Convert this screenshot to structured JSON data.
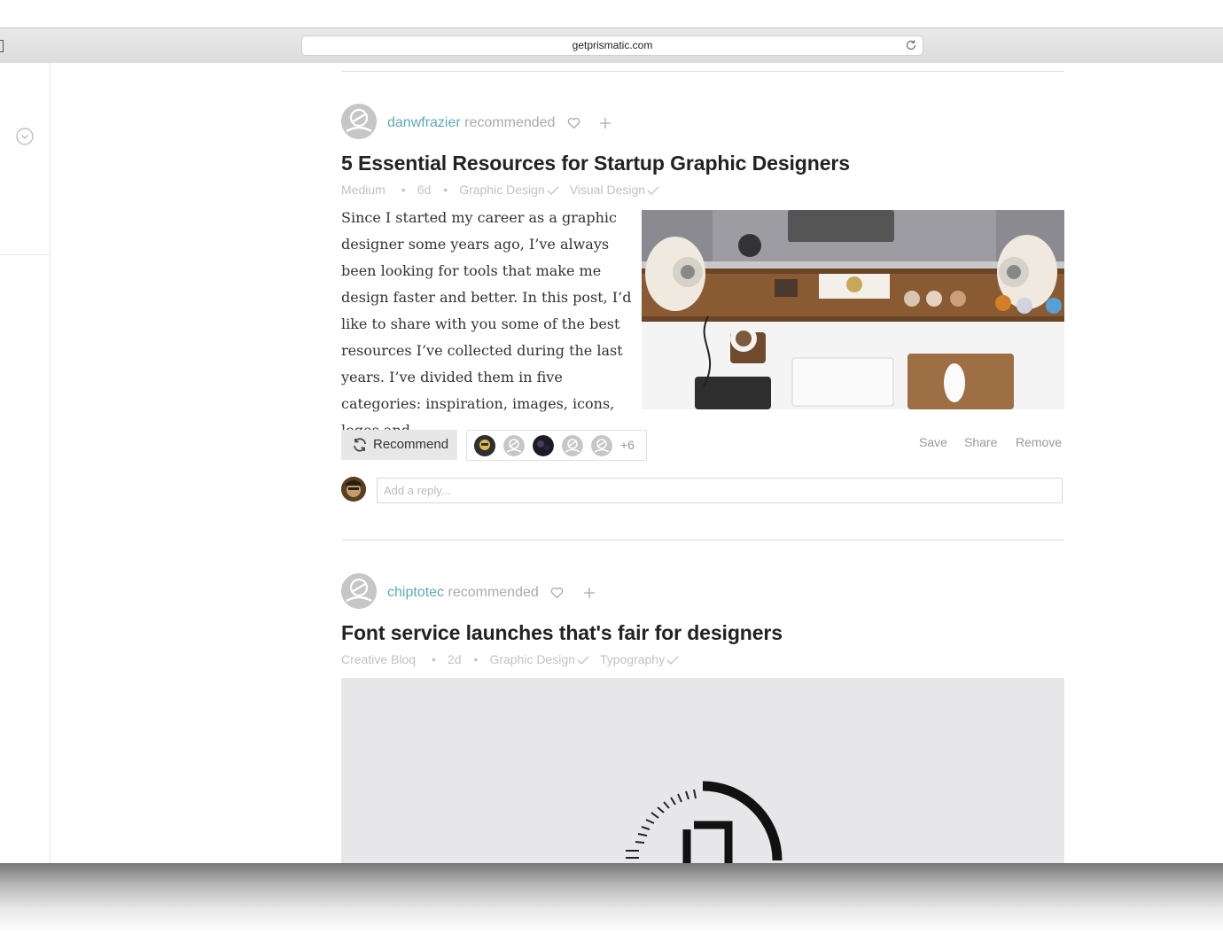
{
  "browser": {
    "url": "getprismatic.com"
  },
  "posts": [
    {
      "recommender": "danwfrazier",
      "recommended_text": "recommended",
      "title": "5 Essential Resources for Startup Graphic Designers",
      "source": "Medium",
      "age": "6d",
      "topics": [
        "Graphic Design",
        "Visual Design"
      ],
      "excerpt": "Since I started my career as a graphic designer some years ago, I’ve always been looking for tools that make me design faster and better. In this post, I’d like to share with you some of the best resources I’ve collected during the last years. I’ve divided them in five categories: inspiration, images, icons, logos and…",
      "recommend_label": "Recommend",
      "more_count": "+6",
      "actions": [
        "Save",
        "Share",
        "Remove"
      ],
      "reply_placeholder": "Add a reply..."
    },
    {
      "recommender": "chiptotec",
      "recommended_text": "recommended",
      "title": "Font service launches that's fair for designers",
      "source": "Creative Bloq",
      "age": "2d",
      "topics": [
        "Graphic Design",
        "Typography"
      ]
    }
  ],
  "icons": {
    "sidebar_toggle": "chevron-down-circle-icon",
    "like": "heart-icon",
    "follow": "plus-icon",
    "topic_check": "check-icon",
    "recommend": "refresh-icon",
    "reload": "reload-icon"
  }
}
